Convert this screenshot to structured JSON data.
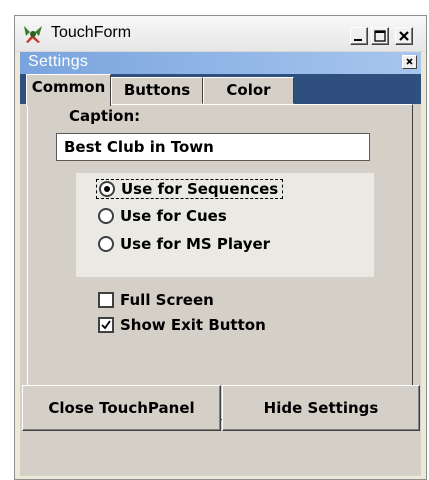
{
  "window": {
    "title": "TouchForm",
    "icon": "touchform-app-icon",
    "buttons": [
      "minimize",
      "maximize",
      "close"
    ]
  },
  "settings_bar": {
    "title": "Settings",
    "close_glyph": "×"
  },
  "tabs": [
    {
      "label": "Common",
      "active": true
    },
    {
      "label": "Buttons",
      "active": false
    },
    {
      "label": "Color",
      "active": false
    }
  ],
  "common": {
    "caption_label": "Caption:",
    "caption_value": "Best Club in Town",
    "radios": [
      {
        "label": "Use for Sequences",
        "selected": true,
        "focused": true
      },
      {
        "label": "Use for Cues",
        "selected": false
      },
      {
        "label": "Use for MS Player",
        "selected": false
      }
    ],
    "checkboxes": [
      {
        "label": "Full Screen",
        "checked": false
      },
      {
        "label": "Show Exit Button",
        "checked": true
      }
    ]
  },
  "footer": {
    "close_panel_label": "Close TouchPanel",
    "hide_settings_label": "Hide Settings"
  },
  "colors": {
    "face": "#d4d0c8",
    "settings_bar_start": "#7aa4de",
    "settings_bar_end": "#a7c6ee",
    "tabstrip": "#2f4f7f"
  }
}
